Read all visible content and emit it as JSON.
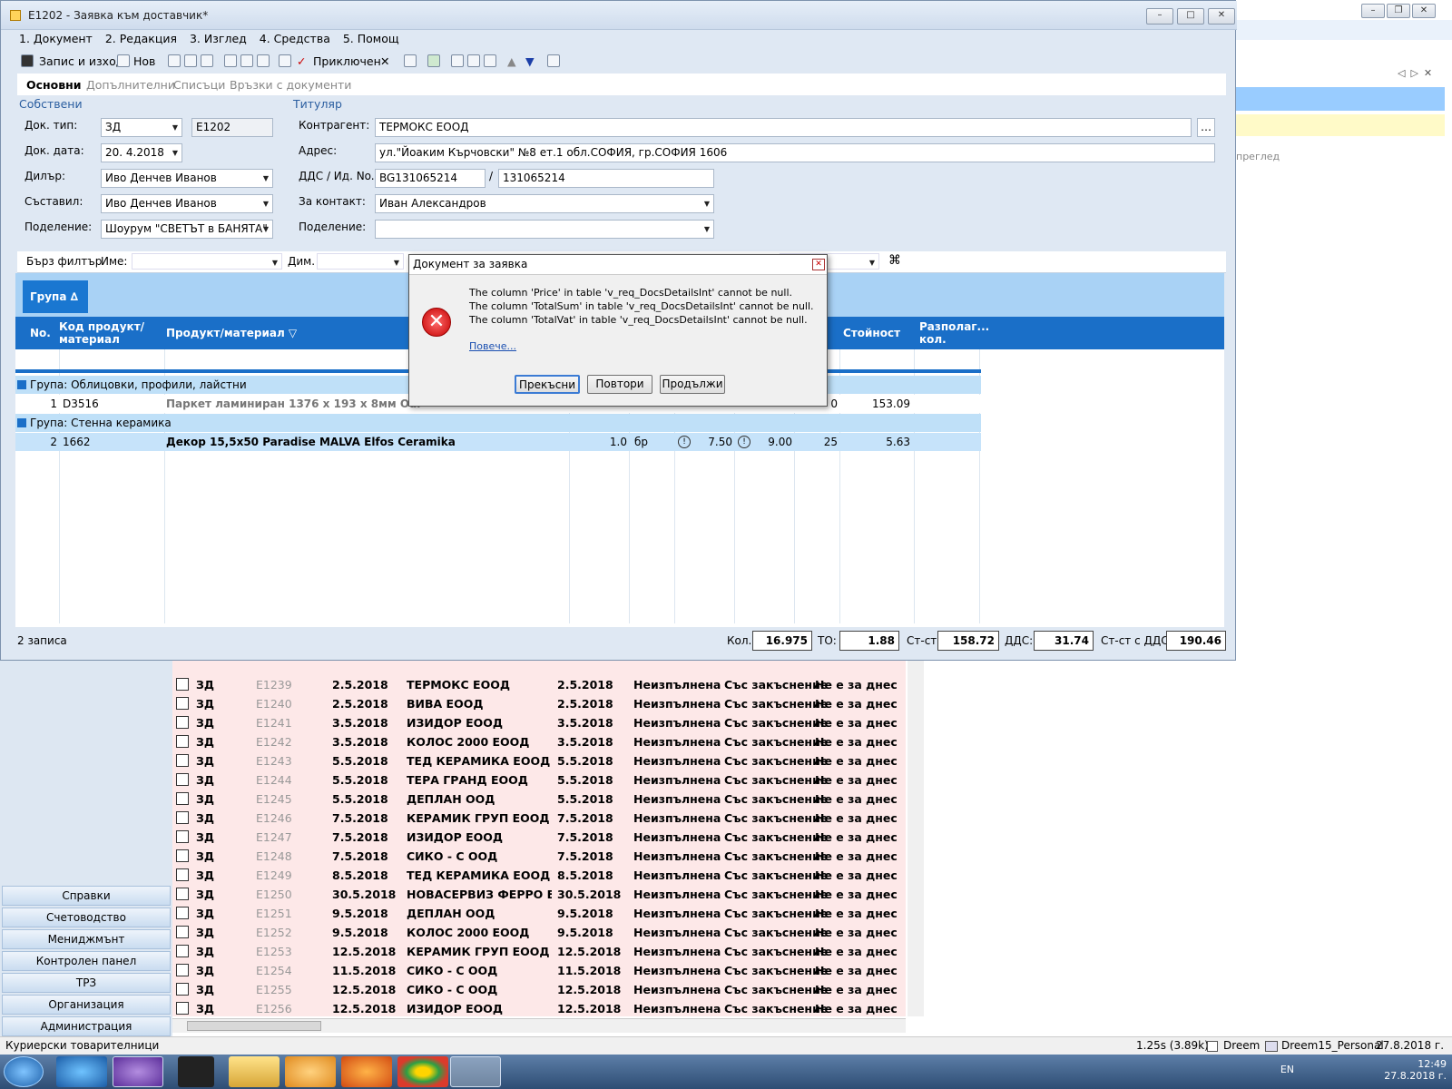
{
  "window": {
    "title": "E1202 - Заявка към доставчик*"
  },
  "menu": [
    "1. Документ",
    "2. Редакция",
    "3. Изглед",
    "4. Средства",
    "5. Помощ"
  ],
  "toolbar": {
    "save_exit": "Запис и изход",
    "new": "Нов",
    "done": "Приключен"
  },
  "tabs": [
    "Основни",
    "Допълнителни",
    "Списъци",
    "Връзки с документи"
  ],
  "form": {
    "own_group": "Собствени",
    "holder_group": "Титуляр",
    "doc_type_label": "Док. тип:",
    "doc_type": "ЗД",
    "doc_number": "E1202",
    "doc_date_label": "Док. дата:",
    "doc_date": "20. 4.2018",
    "dealer_label": "Дилър:",
    "dealer": "Иво Денчев Иванов",
    "author_label": "Съставил:",
    "author": "Иво Денчев Иванов",
    "division_label": "Поделение:",
    "division": "Шоурум \"СВЕТЪТ в БАНЯТА\"",
    "contractor_label": "Контрагент:",
    "contractor": "ТЕРМОКС ЕООД",
    "address_label": "Адрес:",
    "address": "ул.\"Йоаким Кърчовски\" №8 ет.1 обл.СОФИЯ, гр.СОФИЯ 1606",
    "vat_label": "ДДС / Ид. No.",
    "vat": "BG131065214",
    "id_no": "131065214",
    "contact_label": "За контакт:",
    "contact": "Иван Александров",
    "division2_label": "Поделение:",
    "division2": ""
  },
  "filter": {
    "quick": "Бърз филтър",
    "name": "Име:",
    "dim": "Дим."
  },
  "grid": {
    "group_button": "Група ∆",
    "columns": {
      "no": "No.",
      "code": "Код продукт/материал",
      "product": "Продукт/материал ▽",
      "value": "Стойност",
      "avail": "Разполаг... кол."
    },
    "group1": "Група: Облицовки, профили, лайстни",
    "row1": {
      "no": "1",
      "code": "D3516",
      "product": "Паркет ламиниран 1376 x 193 x 8мм Oak Miller",
      "qty2": "0",
      "value": "153.09"
    },
    "group2": "Група: Стенна керамика",
    "row2": {
      "no": "2",
      "code": "1662",
      "product": "Декор 15,5x50 Paradise MALVA Elfos Ceramika",
      "qty": "1.0",
      "unit": "бр",
      "price": "7.50",
      "price2": "9.00",
      "qty2": "25",
      "value": "5.63"
    }
  },
  "summary": {
    "records": "2 записа",
    "qty_label": "Кол.",
    "qty": "16.975",
    "to_label": "ТО:",
    "to": "1.88",
    "cost_label": "Ст-ст:",
    "cost": "158.72",
    "vat_label": "ДДС:",
    "vat": "31.74",
    "cost_vat_label": "Ст-ст с ДДС:",
    "cost_vat": "190.46"
  },
  "dialog": {
    "title": "Документ за заявка",
    "line1": "The column 'Price' in table 'v_req_DocsDetailsInt' cannot be null.",
    "line2": "The column 'TotalSum' in table 'v_req_DocsDetailsInt' cannot be null.",
    "line3": "The column 'TotalVat' in table 'v_req_DocsDetailsInt' cannot be null.",
    "more": "Повече...",
    "abort": "Прекъсни",
    "retry": "Повтори",
    "continue": "Продължи"
  },
  "bg": {
    "preview_label": "преглед",
    "nav": [
      "Справки",
      "Счетоводство",
      "Мениджмънт",
      "Контролен панел",
      "ТРЗ",
      "Организация",
      "Администрация"
    ],
    "list": [
      [
        "ЗД",
        "E1239",
        "2.5.2018",
        "ТЕРМОКС ЕООД",
        "2.5.2018",
        "Неизпълнена",
        "Със закъснение",
        "Не е за днес"
      ],
      [
        "ЗД",
        "E1240",
        "2.5.2018",
        "ВИВА ЕООД",
        "2.5.2018",
        "Неизпълнена",
        "Със закъснение",
        "Не е за днес"
      ],
      [
        "ЗД",
        "E1241",
        "3.5.2018",
        "ИЗИДОР ЕООД",
        "3.5.2018",
        "Неизпълнена",
        "Със закъснение",
        "Не е за днес"
      ],
      [
        "ЗД",
        "E1242",
        "3.5.2018",
        "КОЛОС 2000 ЕООД",
        "3.5.2018",
        "Неизпълнена",
        "Със закъснение",
        "Не е за днес"
      ],
      [
        "ЗД",
        "E1243",
        "5.5.2018",
        "ТЕД КЕРАМИКА ЕООД",
        "5.5.2018",
        "Неизпълнена",
        "Със закъснение",
        "Не е за днес"
      ],
      [
        "ЗД",
        "E1244",
        "5.5.2018",
        "ТЕРА ГРАНД ЕООД",
        "5.5.2018",
        "Неизпълнена",
        "Със закъснение",
        "Не е за днес"
      ],
      [
        "ЗД",
        "E1245",
        "5.5.2018",
        "ДЕПЛАН ООД",
        "5.5.2018",
        "Неизпълнена",
        "Със закъснение",
        "Не е за днес"
      ],
      [
        "ЗД",
        "E1246",
        "7.5.2018",
        "КЕРАМИК ГРУП ЕООД",
        "7.5.2018",
        "Неизпълнена",
        "Със закъснение",
        "Не е за днес"
      ],
      [
        "ЗД",
        "E1247",
        "7.5.2018",
        "ИЗИДОР ЕООД",
        "7.5.2018",
        "Неизпълнена",
        "Със закъснение",
        "Не е за днес"
      ],
      [
        "ЗД",
        "E1248",
        "7.5.2018",
        "СИКО - С ООД",
        "7.5.2018",
        "Неизпълнена",
        "Със закъснение",
        "Не е за днес"
      ],
      [
        "ЗД",
        "E1249",
        "8.5.2018",
        "ТЕД КЕРАМИКА ЕООД",
        "8.5.2018",
        "Неизпълнена",
        "Със закъснение",
        "Не е за днес"
      ],
      [
        "ЗД",
        "E1250",
        "30.5.2018",
        "НОВАСЕРВИЗ ФЕРРО БЪЛ...",
        "30.5.2018",
        "Неизпълнена",
        "Със закъснение",
        "Не е за днес"
      ],
      [
        "ЗД",
        "E1251",
        "9.5.2018",
        "ДЕПЛАН ООД",
        "9.5.2018",
        "Неизпълнена",
        "Със закъснение",
        "Не е за днес"
      ],
      [
        "ЗД",
        "E1252",
        "9.5.2018",
        "КОЛОС 2000 ЕООД",
        "9.5.2018",
        "Неизпълнена",
        "Със закъснение",
        "Не е за днес"
      ],
      [
        "ЗД",
        "E1253",
        "12.5.2018",
        "КЕРАМИК ГРУП ЕООД",
        "12.5.2018",
        "Неизпълнена",
        "Със закъснение",
        "Не е за днес"
      ],
      [
        "ЗД",
        "E1254",
        "11.5.2018",
        "СИКО - С ООД",
        "11.5.2018",
        "Неизпълнена",
        "Със закъснение",
        "Не е за днес"
      ],
      [
        "ЗД",
        "E1255",
        "12.5.2018",
        "СИКО - С ООД",
        "12.5.2018",
        "Неизпълнена",
        "Със закъснение",
        "Не е за днес"
      ],
      [
        "ЗД",
        "E1256",
        "12.5.2018",
        "ИЗИДОР ЕООД",
        "12.5.2018",
        "Неизпълнена",
        "Със закъснение",
        "Не е за днес"
      ]
    ],
    "status_left": "Куриерски товарителници",
    "status_time": "1.25s (3.89k)",
    "status_user": "Dreem",
    "status_db": "Dreem15_Personal",
    "status_date": "27.8.2018 г."
  },
  "tray": {
    "lang": "EN",
    "time": "12:49",
    "date": "27.8.2018 г."
  }
}
